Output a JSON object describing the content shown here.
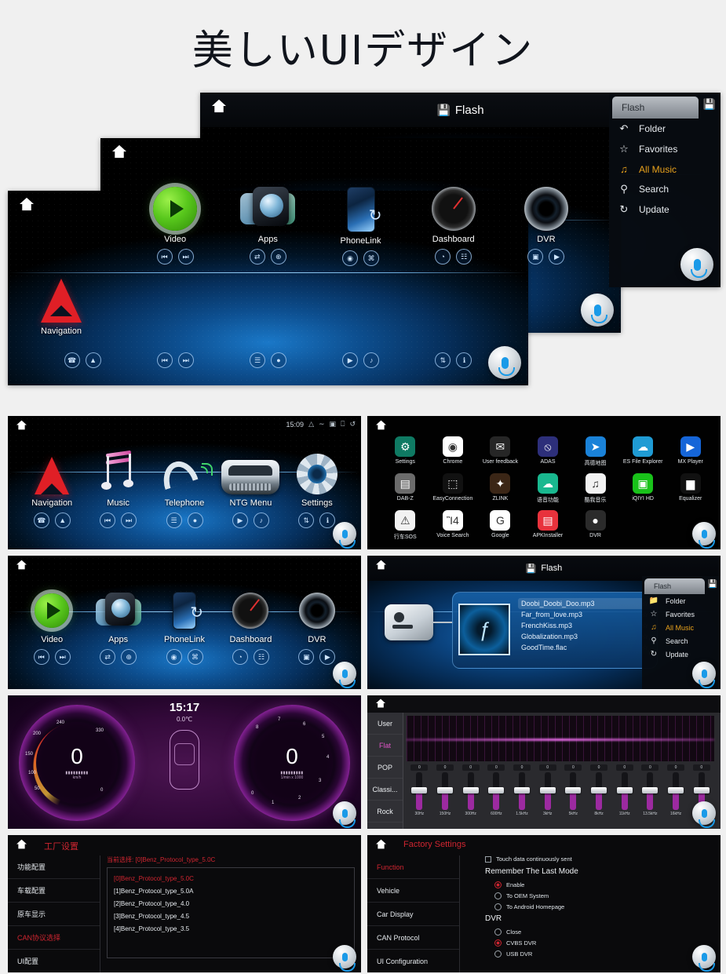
{
  "page": {
    "title": "美しいUIデザイン",
    "background": "#f0f0f0"
  },
  "hero": {
    "flash_header": {
      "label": "Flash",
      "icon": "flash-drive-icon"
    },
    "flash_menu": {
      "tab_label": "Flash",
      "lock_icon": "flash-drive-icon",
      "items": [
        {
          "label": "Folder",
          "icon": "folder-icon",
          "active": false
        },
        {
          "label": "Favorites",
          "icon": "star-icon",
          "active": false
        },
        {
          "label": "All Music",
          "icon": "music-note-icon",
          "active": true
        },
        {
          "label": "Search",
          "icon": "search-icon",
          "active": false
        },
        {
          "label": "Update",
          "icon": "refresh-icon",
          "active": false
        }
      ]
    },
    "middle_screen": {
      "apps": [
        {
          "label": "Video",
          "icon": "play-circle-icon",
          "ctl": [
            "⏮",
            "⏭"
          ]
        },
        {
          "label": "Apps",
          "icon": "apps-globe-icon",
          "ctl": [
            "⇄",
            "⊕"
          ]
        },
        {
          "label": "PhoneLink",
          "icon": "phone-link-icon",
          "ctl": [
            "◉",
            "⌘"
          ]
        },
        {
          "label": "Dashboard",
          "icon": "gauge-icon",
          "ctl": [
            "◔",
            "☷"
          ]
        },
        {
          "label": "DVR",
          "icon": "camera-lens-icon",
          "ctl": [
            "▣",
            "▶"
          ]
        }
      ]
    },
    "front_screen": {
      "nav_label": "Navigation",
      "nav_icon": "navigation-arrow-icon",
      "bottom_controls": [
        [
          "☎",
          "▲"
        ],
        [
          "⏮",
          "⏭"
        ],
        [
          "☰",
          "●"
        ],
        [
          "▶",
          "♪"
        ],
        [
          "⇅",
          "ℹ"
        ]
      ]
    }
  },
  "grid": {
    "home_main": {
      "status": {
        "time": "15:09",
        "icons": [
          "signal-icon",
          "wifi-icon",
          "screen-icon",
          "recents-icon",
          "back-icon"
        ]
      },
      "apps": [
        {
          "label": "Navigation",
          "icon": "navigation-arrow-icon",
          "ctl": [
            "☎",
            "▲"
          ]
        },
        {
          "label": "Music",
          "icon": "music-note-icon",
          "ctl": [
            "⏮",
            "⏭"
          ]
        },
        {
          "label": "Telephone",
          "icon": "telephone-icon",
          "ctl": [
            "☰",
            "●"
          ]
        },
        {
          "label": "NTG Menu",
          "icon": "car-icon",
          "ctl": [
            "▶",
            "♪"
          ]
        },
        {
          "label": "Settings",
          "icon": "gear-icon",
          "ctl": [
            "⇅",
            "ℹ"
          ]
        }
      ]
    },
    "app_drawer": {
      "apps": [
        {
          "label": "Settings",
          "icon": "gear-icon",
          "color": "#0f7a63",
          "glyph": "⚙"
        },
        {
          "label": "Chrome",
          "icon": "chrome-icon",
          "color": "#ffffff",
          "glyph": "◉"
        },
        {
          "label": "User feedback",
          "icon": "feedback-icon",
          "color": "#262626",
          "glyph": "✉"
        },
        {
          "label": "ADAS",
          "icon": "adas-icon",
          "color": "#2d2f7a",
          "glyph": "⦸"
        },
        {
          "label": "高德地图",
          "icon": "amap-icon",
          "color": "#1a82d8",
          "glyph": "➤"
        },
        {
          "label": "ES File Explorer",
          "icon": "es-file-explorer-icon",
          "color": "#1f9bd4",
          "glyph": "☁"
        },
        {
          "label": "MX Player",
          "icon": "mx-player-icon",
          "color": "#1565d8",
          "glyph": "▶"
        },
        {
          "label": "DAB-Z",
          "icon": "dab-radio-icon",
          "color": "#6b6b6b",
          "glyph": "▤"
        },
        {
          "label": "EasyConnection",
          "icon": "easyconnection-icon",
          "color": "#111111",
          "glyph": "⬚"
        },
        {
          "label": "ZLINK",
          "icon": "zlink-icon",
          "color": "#3b2616",
          "glyph": "✦"
        },
        {
          "label": "语音功能",
          "icon": "voice-function-icon",
          "color": "#19b88f",
          "glyph": "☁"
        },
        {
          "label": "酷我音乐",
          "icon": "kuwo-music-icon",
          "color": "#f2f2f2",
          "glyph": "♫"
        },
        {
          "label": "iQIYI HD",
          "icon": "iqiyi-icon",
          "color": "#19c21a",
          "glyph": "▣"
        },
        {
          "label": "Equalizer",
          "icon": "equalizer-icon",
          "color": "#111111",
          "glyph": "▆"
        },
        {
          "label": "行车SOS",
          "icon": "sos-icon",
          "color": "#f2f2f2",
          "glyph": "⚠"
        },
        {
          "label": "Voice Search",
          "icon": "voice-search-icon",
          "color": "#ffffff",
          "glyph": "Ἲ4"
        },
        {
          "label": "Google",
          "icon": "google-icon",
          "color": "#ffffff",
          "glyph": "G"
        },
        {
          "label": "APKInstaller",
          "icon": "apk-installer-icon",
          "color": "#e8323c",
          "glyph": "▤"
        },
        {
          "label": "DVR",
          "icon": "dvr-icon",
          "color": "#2b2b2b",
          "glyph": "●"
        }
      ]
    },
    "home_media": {
      "apps": [
        {
          "label": "Video",
          "icon": "play-circle-icon",
          "ctl": [
            "⏮",
            "⏭"
          ]
        },
        {
          "label": "Apps",
          "icon": "apps-globe-icon",
          "ctl": [
            "⇄",
            "⊕"
          ]
        },
        {
          "label": "PhoneLink",
          "icon": "phone-link-icon",
          "ctl": [
            "◉",
            "⌘"
          ]
        },
        {
          "label": "Dashboard",
          "icon": "gauge-icon",
          "ctl": [
            "◔",
            "☷"
          ]
        },
        {
          "label": "DVR",
          "icon": "camera-lens-icon",
          "ctl": [
            "▣",
            "▶"
          ]
        }
      ]
    },
    "flash_player": {
      "header": "Flash",
      "album_glyph": "ƒ",
      "tracks": [
        {
          "name": "Doobi_Doobi_Doo.mp3",
          "selected": true,
          "star": "☆"
        },
        {
          "name": "Far_from_love.mp3",
          "selected": false,
          "star": "☆"
        },
        {
          "name": "FrenchKiss.mp3",
          "selected": false,
          "star": "☆"
        },
        {
          "name": "Globalization.mp3",
          "selected": false,
          "star": "☆"
        },
        {
          "name": "GoodTime.flac",
          "selected": false,
          "star": "☆"
        }
      ],
      "menu": {
        "tab_label": "Flash",
        "items": [
          {
            "label": "Folder",
            "icon": "folder-icon",
            "active": false
          },
          {
            "label": "Favorites",
            "icon": "star-icon",
            "active": false
          },
          {
            "label": "All Music",
            "icon": "music-note-icon",
            "active": true
          },
          {
            "label": "Search",
            "icon": "search-icon",
            "active": false
          },
          {
            "label": "Update",
            "icon": "refresh-icon",
            "active": false
          }
        ]
      }
    },
    "instrument_cluster": {
      "time": "15:17",
      "temperature": "0.0℃",
      "speedometer": {
        "value": "0",
        "unit": "km/h",
        "ticks": [
          "0",
          "50",
          "100",
          "150",
          "200",
          "240",
          "330"
        ]
      },
      "tachometer": {
        "value": "0",
        "unit": "1/min x 1000",
        "ticks": [
          "0",
          "1",
          "2",
          "3",
          "4",
          "5",
          "6",
          "7",
          "8"
        ]
      }
    },
    "equalizer": {
      "presets": [
        {
          "label": "User",
          "active": false
        },
        {
          "label": "Flat",
          "active": true
        },
        {
          "label": "POP",
          "active": false
        },
        {
          "label": "Classi...",
          "active": false
        },
        {
          "label": "Rock",
          "active": false
        }
      ],
      "bands": [
        {
          "freq": "30Hz",
          "value": "0"
        },
        {
          "freq": "150Hz",
          "value": "0"
        },
        {
          "freq": "300Hz",
          "value": "0"
        },
        {
          "freq": "600Hz",
          "value": "0"
        },
        {
          "freq": "1.5kHz",
          "value": "0"
        },
        {
          "freq": "3kHz",
          "value": "0"
        },
        {
          "freq": "5kHz",
          "value": "0"
        },
        {
          "freq": "8kHz",
          "value": "0"
        },
        {
          "freq": "11kHz",
          "value": "0"
        },
        {
          "freq": "13.5kHz",
          "value": "0"
        },
        {
          "freq": "16kHz",
          "value": "0"
        },
        {
          "freq": "20kHz",
          "value": "0"
        }
      ]
    },
    "factory_settings_cn": {
      "title": "工厂设置",
      "side_items": [
        {
          "label": "功能配置",
          "active": false
        },
        {
          "label": "车载配置",
          "active": false
        },
        {
          "label": "原车显示",
          "active": false
        },
        {
          "label": "CAN协议选择",
          "active": true
        },
        {
          "label": "UI配置",
          "active": false
        }
      ],
      "current_label": "当前选择:",
      "current_value": "[0]Benz_Protocol_type_5.0C",
      "options": [
        {
          "label": "[0]Benz_Protocol_type_5.0C",
          "selected": true
        },
        {
          "label": "[1]Benz_Protocol_type_5.0A",
          "selected": false
        },
        {
          "label": "[2]Benz_Protocol_type_4.0",
          "selected": false
        },
        {
          "label": "[3]Benz_Protocol_type_4.5",
          "selected": false
        },
        {
          "label": "[4]Benz_Protocol_type_3.5",
          "selected": false
        }
      ]
    },
    "factory_settings_en": {
      "title": "Factory Settings",
      "side_items": [
        {
          "label": "Function",
          "active": true
        },
        {
          "label": "Vehicle",
          "active": false
        },
        {
          "label": "Car Display",
          "active": false
        },
        {
          "label": "CAN Protocol",
          "active": false
        },
        {
          "label": "UI Configuration",
          "active": false
        }
      ],
      "checkbox": {
        "label": "Touch data continuously sent",
        "checked": false
      },
      "groups": [
        {
          "title": "Remember The Last Mode",
          "options": [
            {
              "label": "Enable",
              "selected": true
            },
            {
              "label": "To OEM System",
              "selected": false
            },
            {
              "label": "To Android Homepage",
              "selected": false
            }
          ]
        },
        {
          "title": "DVR",
          "options": [
            {
              "label": "Close",
              "selected": false
            },
            {
              "label": "CVBS DVR",
              "selected": true
            },
            {
              "label": "USB DVR",
              "selected": false
            }
          ]
        }
      ]
    }
  }
}
